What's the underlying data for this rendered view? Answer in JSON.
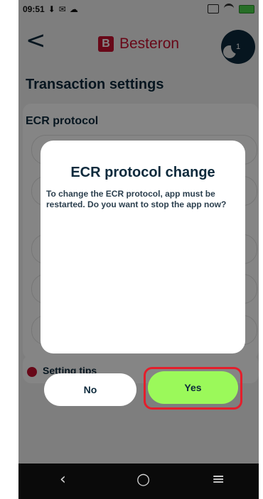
{
  "status_bar": {
    "time": "09:51"
  },
  "header": {
    "brand": "Besteron",
    "notification_count": "1"
  },
  "page": {
    "title": "Transaction settings",
    "section_title": "ECR protocol",
    "tips_label": "Setting tips"
  },
  "dialog": {
    "title": "ECR protocol change",
    "message": "To change the ECR protocol, app must be restarted. Do you want to stop the app now?",
    "no_label": "No",
    "yes_label": "Yes"
  },
  "nav": {
    "back": "‹",
    "home": "○",
    "menu": "≡"
  },
  "colors": {
    "brand": "#c8102e",
    "primary_dark": "#0d2a3c",
    "yes_button": "#9bf95a",
    "highlight": "#e41e2b"
  },
  "icons": [
    "back-arrow-icon",
    "besteron-logo-icon",
    "avatar-icon",
    "notification-badge",
    "tips-icon"
  ]
}
